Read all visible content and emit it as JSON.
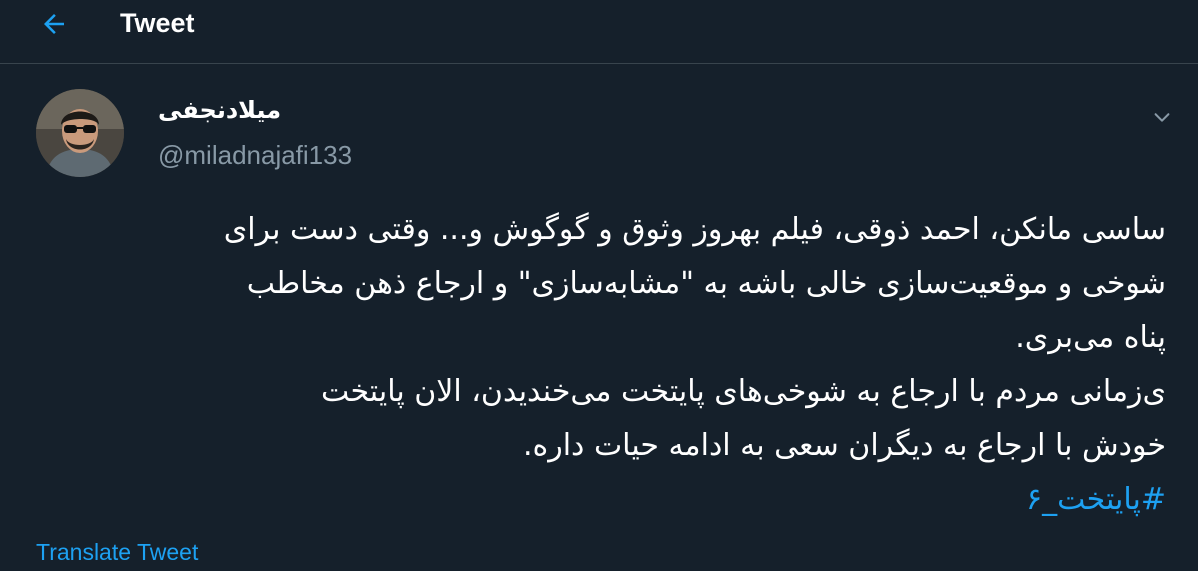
{
  "header": {
    "back_icon": "arrow-left-icon",
    "title": "Tweet"
  },
  "author": {
    "display_name": "میلادنجفی",
    "handle": "@miladnajafi133"
  },
  "tweet": {
    "lines": [
      "ساسی مانکن، احمد ذوقی، فیلم بهروز وثوق و گوگوش و... وقتی دست برای",
      "شوخی و موقعیت‌سازی خالی باشه به \"مشابه‌سازی\" و ارجاع ذهن مخاطب",
      "پناه می‌بری.",
      "ی‌زمانی مردم با ارجاع به شوخی‌های پایتخت می‌خندیدن، الان پایتخت",
      "خودش با ارجاع به دیگران سعی به ادامه حیات داره."
    ],
    "hashtag": "#پایتخت_۶"
  },
  "translate_label": "Translate Tweet",
  "colors": {
    "background": "#15202b",
    "accent": "#1da1f2",
    "secondary_text": "#8899a6",
    "divider": "#38444d"
  }
}
